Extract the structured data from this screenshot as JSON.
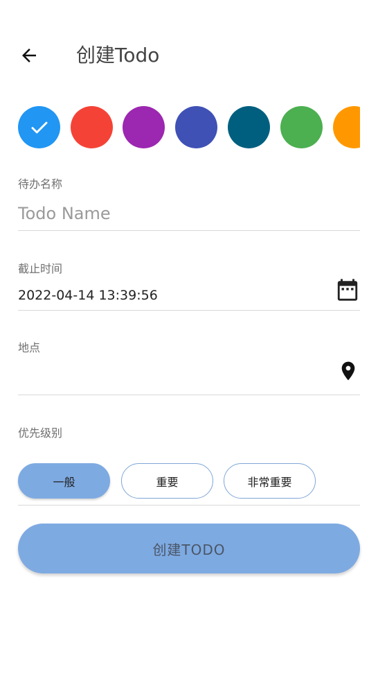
{
  "header": {
    "title": "创建Todo"
  },
  "colors": {
    "selected_index": 0,
    "swatches": [
      "#2196f3",
      "#f44336",
      "#9c27b0",
      "#3f51b5",
      "#005f7f",
      "#4caf50",
      "#ff9800"
    ]
  },
  "form": {
    "name": {
      "label": "待办名称",
      "value": "",
      "placeholder": "Todo Name"
    },
    "deadline": {
      "label": "截止时间",
      "value": "2022-04-14 13:39:56",
      "icon": "calendar-icon"
    },
    "location": {
      "label": "地点",
      "value": "",
      "icon": "location-pin-icon"
    }
  },
  "priority": {
    "label": "优先级别",
    "options": [
      "一般",
      "重要",
      "非常重要"
    ],
    "selected_index": 0,
    "accent": "#7eaae2"
  },
  "submit": {
    "label": "创建TODO"
  }
}
